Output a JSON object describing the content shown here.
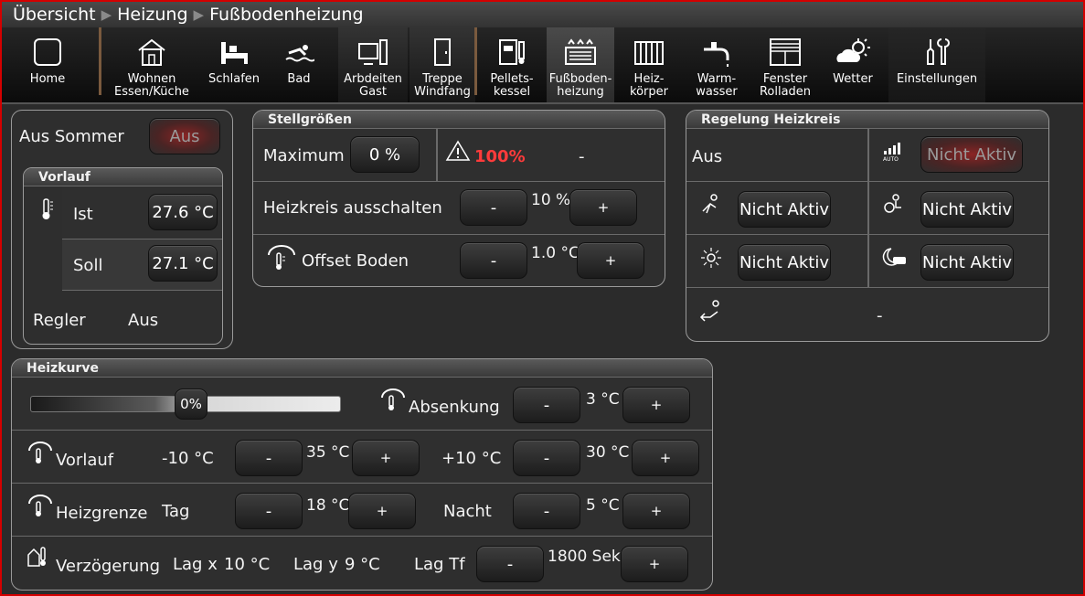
{
  "breadcrumb": {
    "items": [
      "Übersicht",
      "Heizung",
      "Fußbodenheizung"
    ]
  },
  "nav": {
    "items": [
      {
        "label": "Home",
        "icon": "home-square-icon"
      },
      {
        "label": "Wohnen\nEssen/Küche",
        "icon": "house-icon"
      },
      {
        "label": "Schlafen",
        "icon": "bed-icon"
      },
      {
        "label": "Bad",
        "icon": "swimmer-icon"
      },
      {
        "label": "Arbdeiten\nGast",
        "icon": "computer-icon"
      },
      {
        "label": "Treppe\nWindfang",
        "icon": "door-icon"
      },
      {
        "label": "Pellets-\nkessel",
        "icon": "boiler-icon"
      },
      {
        "label": "Fußboden-\nheizung",
        "icon": "floor-heating-icon"
      },
      {
        "label": "Heiz-\nkörper",
        "icon": "radiator-icon"
      },
      {
        "label": "Warm-\nwasser",
        "icon": "faucet-icon"
      },
      {
        "label": "Fenster\nRolladen",
        "icon": "window-icon"
      },
      {
        "label": "Wetter",
        "icon": "weather-icon"
      },
      {
        "label": "Einstellungen",
        "icon": "tools-icon"
      }
    ]
  },
  "left": {
    "aus_sommer_label": "Aus Sommer",
    "aus_sommer_button": "Aus",
    "vorlauf_title": "Vorlauf",
    "ist_label": "Ist",
    "ist_value": "27.6 °C",
    "soll_label": "Soll",
    "soll_value": "27.1 °C",
    "regler_label": "Regler",
    "regler_value": "Aus"
  },
  "stell": {
    "title": "Stellgrößen",
    "maximum_label": "Maximum",
    "maximum_value": "0 %",
    "alarm_value": "100%",
    "alarm_extra": "-",
    "heizkreis_label": "Heizkreis ausschalten",
    "heizkreis_value": "10 %",
    "offset_label": "Offset Boden",
    "offset_value": "1.0 °C",
    "minus": "-",
    "plus": "+"
  },
  "regelung": {
    "title": "Regelung Heizkreis",
    "status": "Aus",
    "auto_button": "Nicht Aktiv",
    "b1": "Nicht Aktiv",
    "b2": "Nicht Aktiv",
    "b3": "Nicht Aktiv",
    "b4": "Nicht Aktiv",
    "bottom_value": "-"
  },
  "heizkurve": {
    "title": "Heizkurve",
    "slider_value": "0%",
    "slider_level": 0,
    "absenkung_label": "Absenkung",
    "absenkung_value": "3 °C",
    "vorlauf_label": "Vorlauf",
    "vorlauf_low": "-10 °C",
    "vorlauf_low_value": "35 °C",
    "vorlauf_high": "+10 °C",
    "vorlauf_high_value": "30 °C",
    "heizgrenze_label": "Heizgrenze",
    "tag_label": "Tag",
    "tag_value": "18 °C",
    "nacht_label": "Nacht",
    "nacht_value": "5 °C",
    "verz_label": "Verzögerung",
    "lagx_label": "Lag x",
    "lagx_value": "10 °C",
    "lagy_label": "Lag y",
    "lagy_value": "9 °C",
    "lagtf_label": "Lag Tf",
    "lagtf_value": "1800 Sek"
  },
  "colors": {
    "alarm": "#ff3b3b",
    "frame": "#d40000",
    "divider": "#7a5a3e"
  }
}
